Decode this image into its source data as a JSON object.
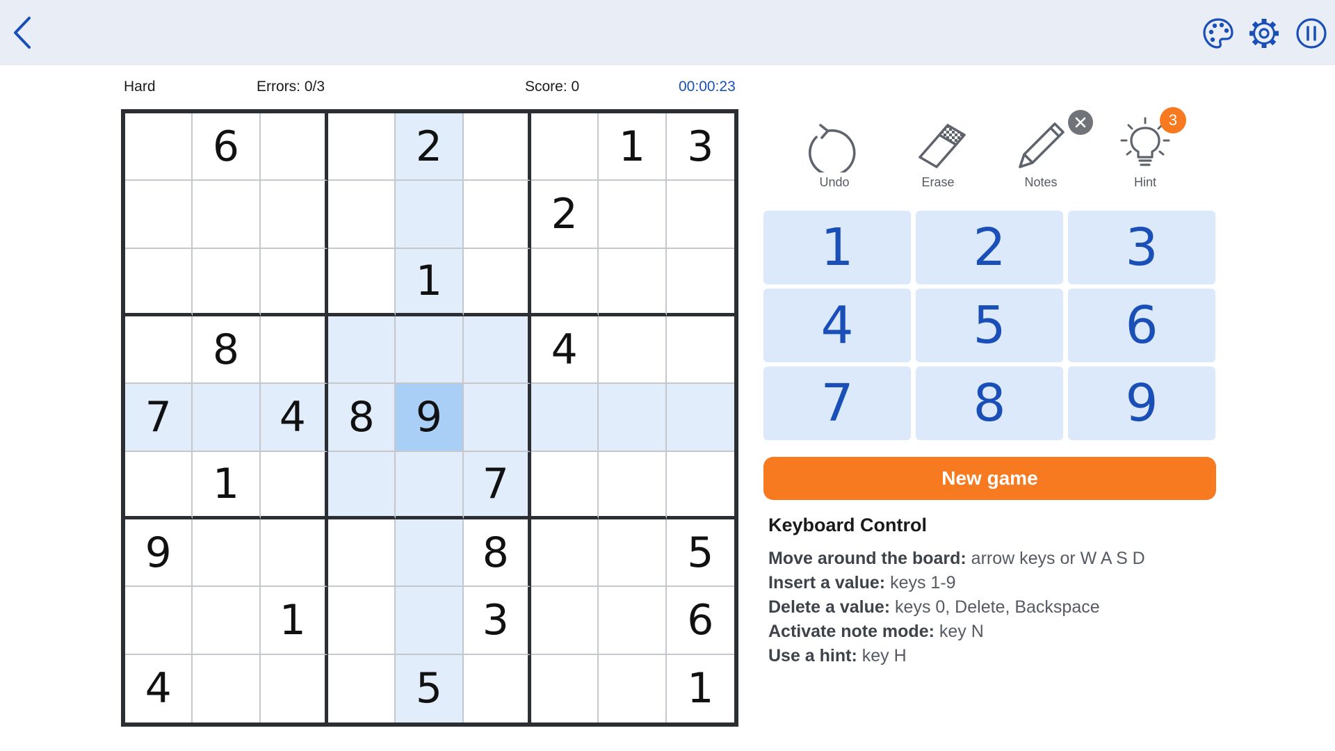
{
  "header": {
    "back_icon": "chevron-left-icon",
    "theme_icon": "palette-icon",
    "settings_icon": "gear-icon",
    "pause_icon": "pause-icon",
    "accent_color": "#1a4fb8",
    "bar_color": "#e8edf6"
  },
  "stats": {
    "difficulty": "Hard",
    "errors": "Errors: 0/3",
    "score": "Score: 0",
    "time": "00:00:23"
  },
  "board": {
    "selected": [
      4,
      4
    ],
    "cells": [
      [
        "",
        "6",
        "",
        "",
        "2",
        "",
        "",
        "1",
        "3"
      ],
      [
        "",
        "",
        "",
        "",
        "",
        "",
        "2",
        "",
        ""
      ],
      [
        "",
        "",
        "",
        "",
        "1",
        "",
        "",
        "",
        ""
      ],
      [
        "",
        "8",
        "",
        "",
        "",
        "",
        "4",
        "",
        ""
      ],
      [
        "7",
        "",
        "4",
        "8",
        "9",
        "",
        "",
        "",
        ""
      ],
      [
        "",
        "1",
        "",
        "",
        "",
        "7",
        "",
        "",
        ""
      ],
      [
        "9",
        "",
        "",
        "",
        "",
        "8",
        "",
        "",
        "5"
      ],
      [
        "",
        "",
        "1",
        "",
        "",
        "3",
        "",
        "",
        "6"
      ],
      [
        "4",
        "",
        "",
        "",
        "5",
        "",
        "",
        "",
        "1"
      ]
    ],
    "highlight_color": "#e1edfb",
    "selected_color": "#a9cff7"
  },
  "tools": {
    "undo": {
      "label": "Undo",
      "icon": "undo-icon"
    },
    "erase": {
      "label": "Erase",
      "icon": "eraser-icon"
    },
    "notes": {
      "label": "Notes",
      "icon": "pencil-icon",
      "badge_icon": "close-icon"
    },
    "hint": {
      "label": "Hint",
      "icon": "lightbulb-icon",
      "count": "3"
    }
  },
  "numpad": [
    "1",
    "2",
    "3",
    "4",
    "5",
    "6",
    "7",
    "8",
    "9"
  ],
  "new_game": {
    "label": "New game",
    "color": "#f77a21"
  },
  "keyboard": {
    "title": "Keyboard Control",
    "lines": [
      {
        "key": "Move around the board:",
        "value": " arrow keys or W A S D"
      },
      {
        "key": "Insert a value:",
        "value": " keys 1-9"
      },
      {
        "key": "Delete a value:",
        "value": " keys 0, Delete, Backspace"
      },
      {
        "key": "Activate note mode:",
        "value": " key N"
      },
      {
        "key": "Use a hint:",
        "value": " key H"
      }
    ]
  }
}
